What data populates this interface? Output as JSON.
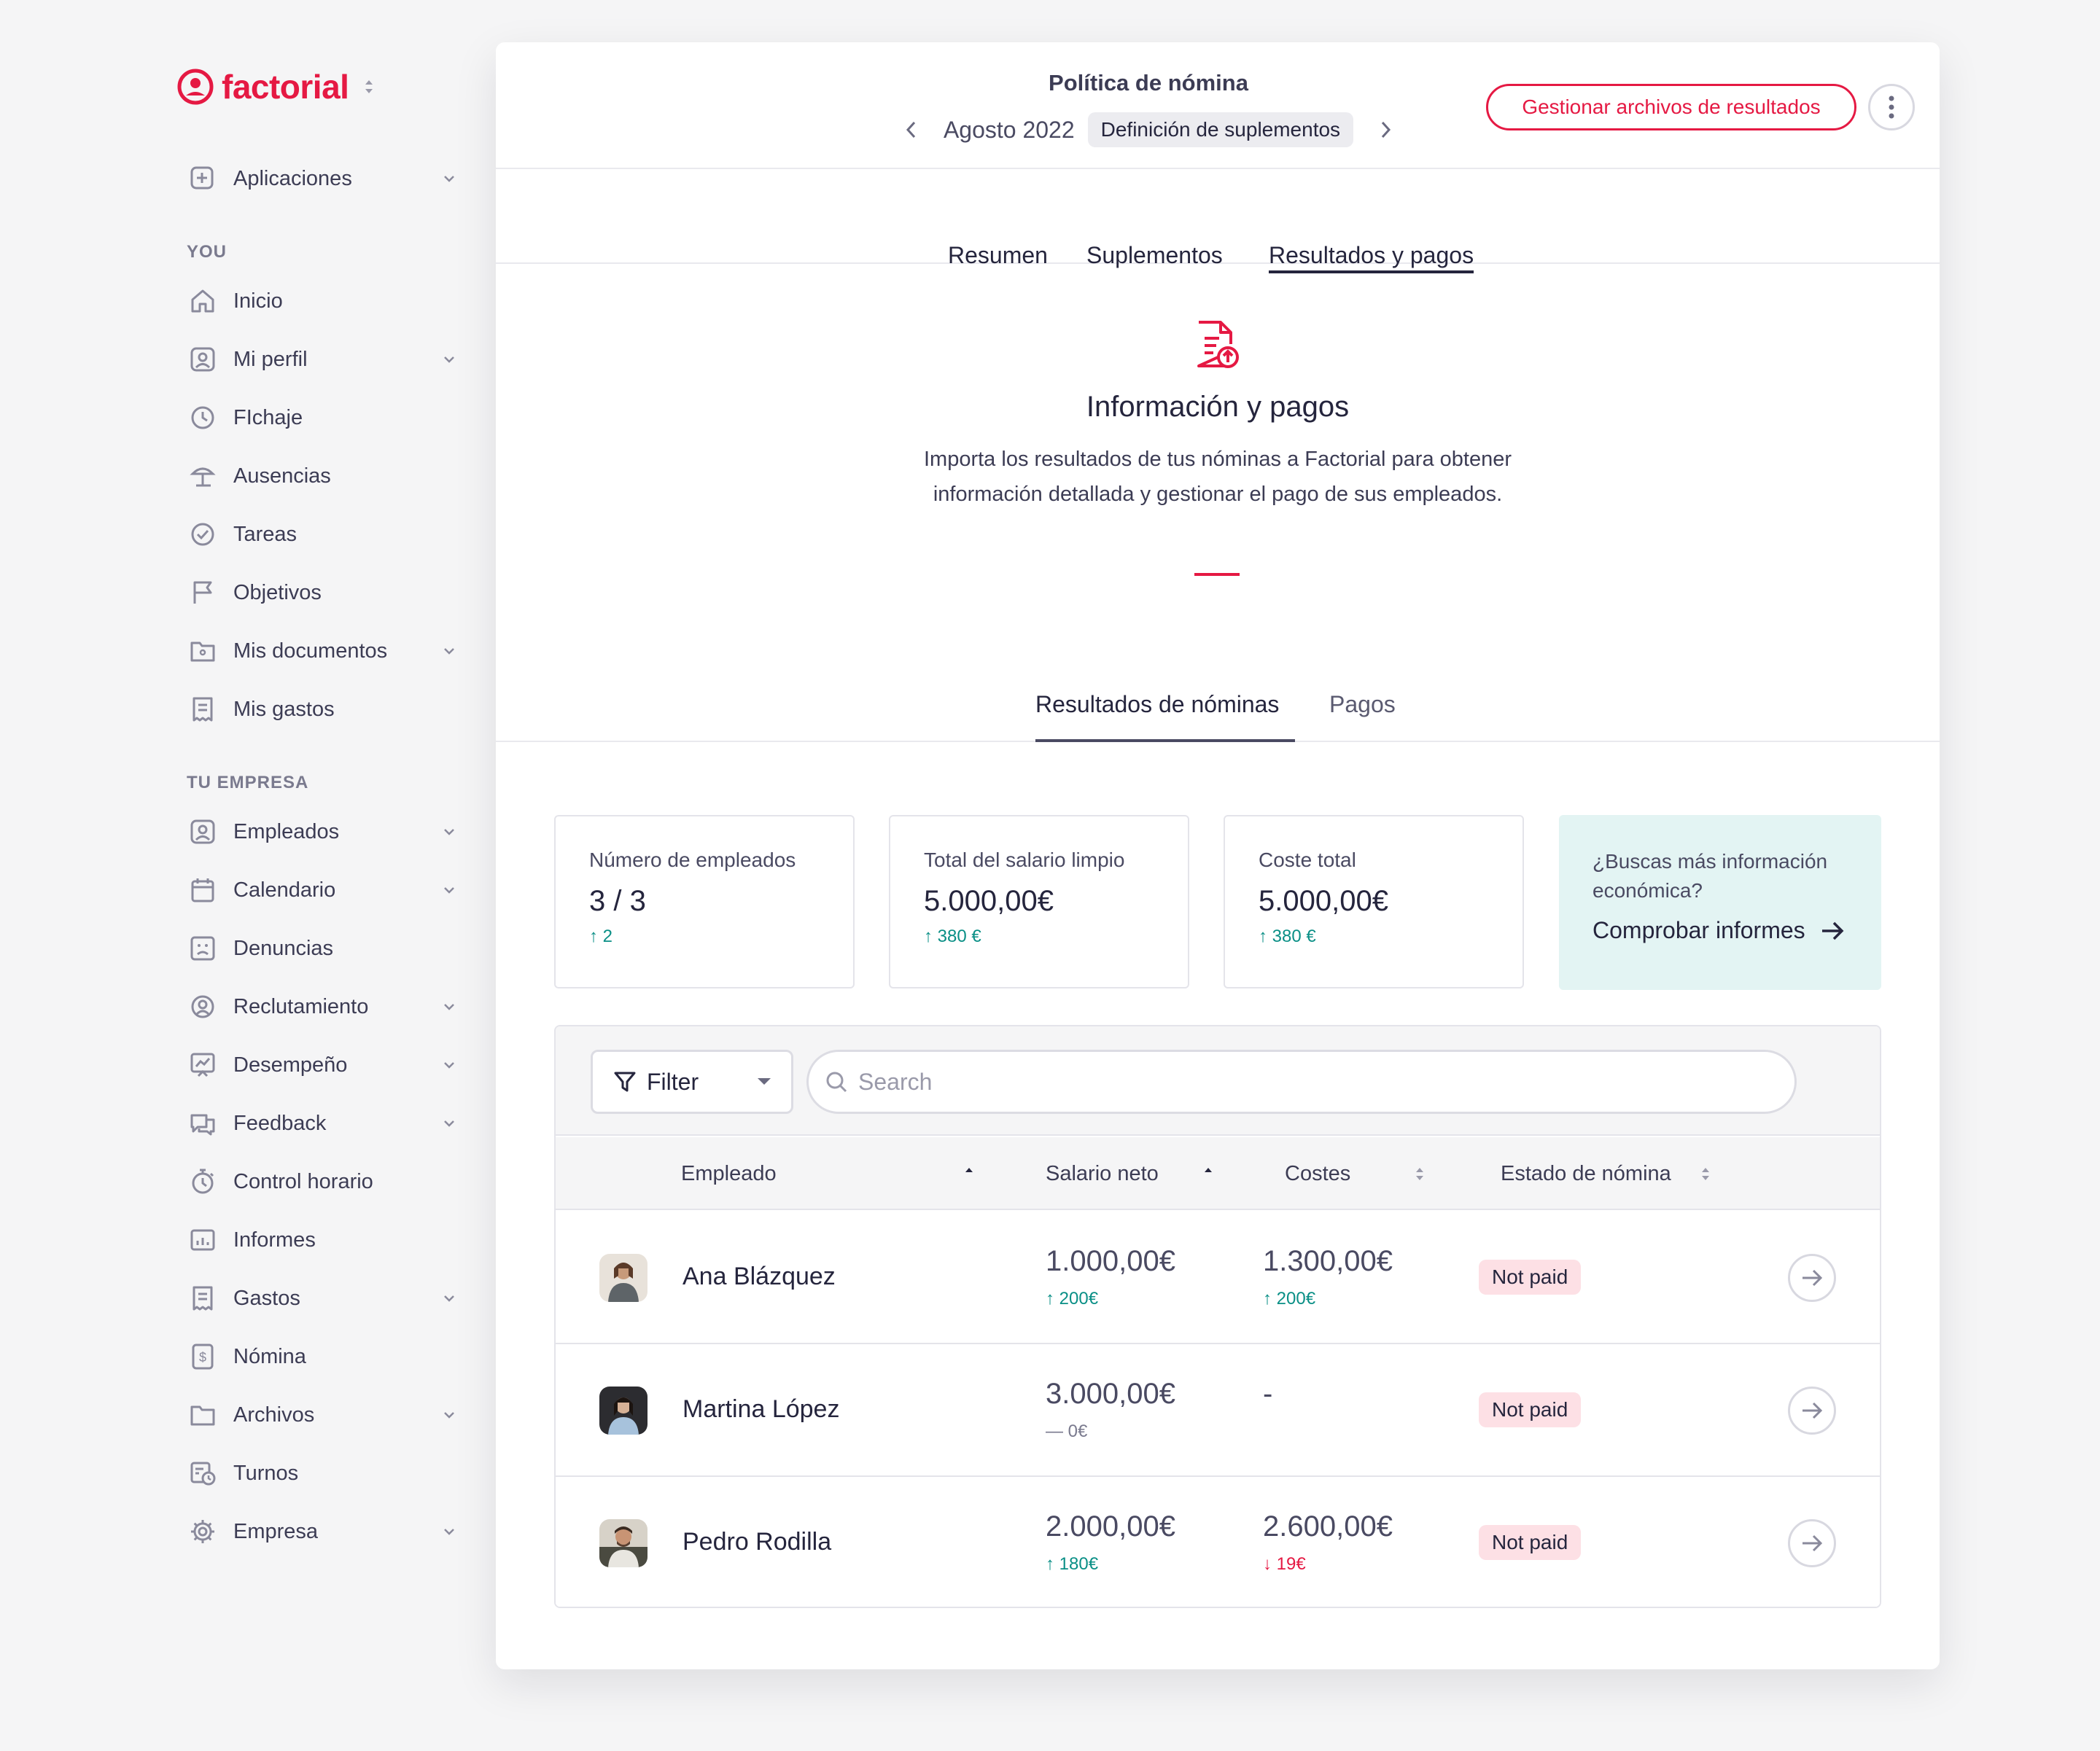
{
  "brand": {
    "name": "factorial",
    "color": "#e51943"
  },
  "sidebar": {
    "apps_label": "Aplicaciones",
    "section_you": "YOU",
    "section_company": "TU EMPRESA",
    "items": [
      {
        "label": "Inicio"
      },
      {
        "label": "Mi perfil"
      },
      {
        "label": "FIchaje"
      },
      {
        "label": "Ausencias"
      },
      {
        "label": "Tareas"
      },
      {
        "label": "Objetivos"
      },
      {
        "label": "Mis documentos"
      },
      {
        "label": "Mis gastos"
      },
      {
        "label": "Empleados"
      },
      {
        "label": "Calendario"
      },
      {
        "label": "Denuncias"
      },
      {
        "label": "Reclutamiento"
      },
      {
        "label": "Desempeño"
      },
      {
        "label": "Feedback"
      },
      {
        "label": "Control horario"
      },
      {
        "label": "Informes"
      },
      {
        "label": "Gastos"
      },
      {
        "label": "Nómina"
      },
      {
        "label": "Archivos"
      },
      {
        "label": "Turnos"
      },
      {
        "label": "Empresa"
      }
    ]
  },
  "header": {
    "title": "Política de nómina",
    "period": "Agosto 2022",
    "stage": "Definición de suplementos",
    "manage_button": "Gestionar archivos de resultados"
  },
  "tabs": [
    "Resumen",
    "Suplementos",
    "Resultados y pagos"
  ],
  "hero": {
    "title": "Información y pagos",
    "text": "Importa los resultados de tus nóminas a Factorial para obtener información detallada y gestionar el pago de sus empleados."
  },
  "subtabs": [
    "Resultados de nóminas",
    "Pagos"
  ],
  "stats": [
    {
      "title": "Número de empleados",
      "value": "3 / 3",
      "delta": "↑ 2"
    },
    {
      "title": "Total del salario limpio",
      "value": "5.000,00€",
      "delta": "↑ 380 €"
    },
    {
      "title": "Coste total",
      "value": "5.000,00€",
      "delta": "↑ 380 €"
    }
  ],
  "promo": {
    "title": "¿Buscas más información económica?",
    "link": "Comprobar informes"
  },
  "table": {
    "filter_label": "Filter",
    "search_placeholder": "Search",
    "columns": [
      "Empleado",
      "Salario neto",
      "Costes",
      "Estado de nómina"
    ],
    "rows": [
      {
        "name": "Ana Blázquez",
        "net": "1.000,00€",
        "net_delta": "↑ 200€",
        "cost": "1.300,00€",
        "cost_delta": "↑ 200€",
        "status": "Not paid"
      },
      {
        "name": "Martina López",
        "net": "3.000,00€",
        "net_delta": "— 0€",
        "cost": "-",
        "cost_delta": "",
        "status": "Not paid"
      },
      {
        "name": "Pedro Rodilla",
        "net": "2.000,00€",
        "net_delta": "↑ 180€",
        "cost": "2.600,00€",
        "cost_delta": "↓ 19€",
        "status": "Not paid"
      }
    ]
  }
}
